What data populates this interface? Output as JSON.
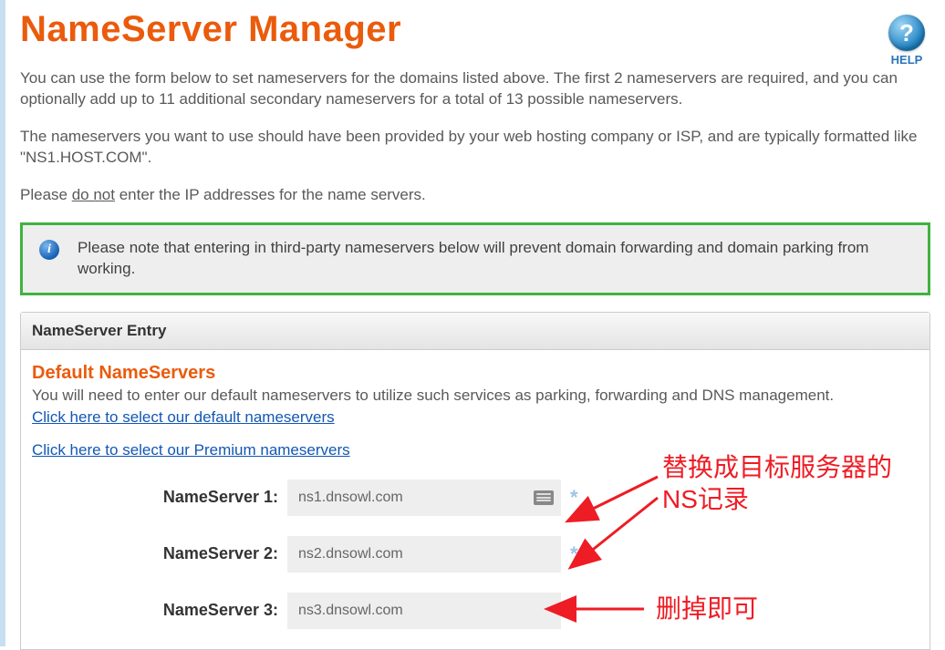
{
  "header": {
    "title": "NameServer Manager",
    "help_label": "HELP"
  },
  "intro": {
    "p1": "You can use the form below to set nameservers for the domains listed above. The first 2 nameservers are required, and you can optionally add up to 11 additional secondary nameservers for a total of 13 possible nameservers.",
    "p2": "The nameservers you want to use should have been provided by your web hosting company or ISP, and are typically formatted like \"NS1.HOST.COM\".",
    "p3_pre": "Please ",
    "p3_underline": "do not",
    "p3_post": " enter the IP addresses for the name servers."
  },
  "notice": "Please note that entering in third-party nameservers below will prevent domain forwarding and domain parking from working.",
  "panel": {
    "header": "NameServer Entry",
    "default_title": "Default NameServers",
    "default_desc": "You will need to enter our default nameservers to utilize such services as parking, forwarding and DNS management.",
    "link_default": "Click here to select our default nameservers",
    "link_premium": "Click here to select our Premium nameservers"
  },
  "fields": {
    "ns1": {
      "label": "NameServer 1:",
      "value": "ns1.dnsowl.com"
    },
    "ns2": {
      "label": "NameServer 2:",
      "value": "ns2.dnsowl.com"
    },
    "ns3": {
      "label": "NameServer 3:",
      "value": "ns3.dnsowl.com"
    }
  },
  "annotations": {
    "a1": "替换成目标服务器的NS记录",
    "a2": "删掉即可"
  }
}
